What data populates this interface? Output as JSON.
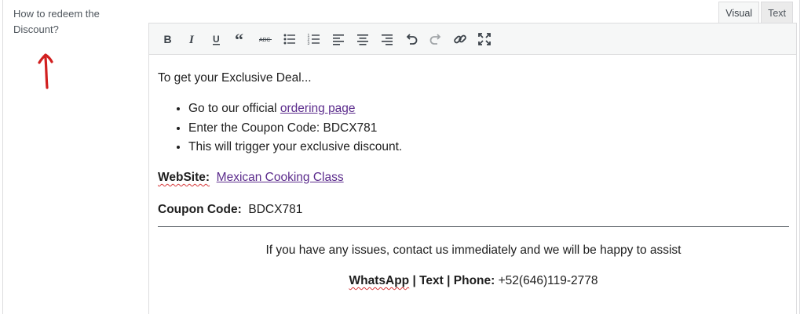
{
  "field": {
    "label": "How to redeem the Discount?"
  },
  "tabs": [
    {
      "label": "Visual",
      "active": true
    },
    {
      "label": "Text",
      "active": false
    }
  ],
  "toolbar": {
    "buttons": [
      {
        "name": "bold-icon"
      },
      {
        "name": "italic-icon"
      },
      {
        "name": "underline-icon"
      },
      {
        "name": "blockquote-icon"
      },
      {
        "name": "strikethrough-icon"
      },
      {
        "name": "bulleted-list-icon"
      },
      {
        "name": "numbered-list-icon"
      },
      {
        "name": "align-left-icon"
      },
      {
        "name": "align-center-icon"
      },
      {
        "name": "align-right-icon"
      },
      {
        "name": "undo-icon"
      },
      {
        "name": "redo-icon"
      },
      {
        "name": "insert-link-icon"
      },
      {
        "name": "fullscreen-icon"
      }
    ]
  },
  "content": {
    "intro": "To get your Exclusive Deal...",
    "steps": {
      "step1_prefix": "Go to our official ",
      "step1_link": "ordering page",
      "step2": "Enter the Coupon Code:  BDCX781",
      "step3": "This will trigger your exclusive discount."
    },
    "website_label": "WebSite:",
    "website_link": "Mexican Cooking Class",
    "coupon_label": "Coupon Code:",
    "coupon_value": "BDCX781",
    "contact_text": "If you have any issues, contact us immediately and we will be happy to assist",
    "contact_whatsapp": "WhatsApp",
    "contact_rest": " | Text | Phone:",
    "contact_phone": "+52(646)119-2778"
  },
  "colors": {
    "link": "#5b2b8c",
    "annotation": "#d11f1f"
  }
}
